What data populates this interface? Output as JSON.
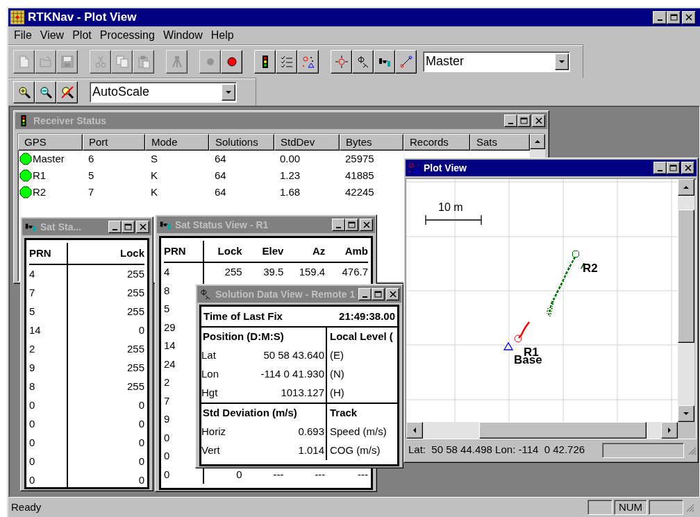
{
  "app": {
    "title": "RTKNav - Plot View"
  },
  "menu": [
    "File",
    "View",
    "Plot",
    "Processing",
    "Window",
    "Help"
  ],
  "toolbar": {
    "groups": [
      [
        {
          "kind": "new",
          "disabled": true
        },
        {
          "kind": "open",
          "disabled": true
        },
        {
          "kind": "save",
          "disabled": true
        }
      ],
      [
        {
          "kind": "cut",
          "disabled": true
        },
        {
          "kind": "copy",
          "disabled": true
        },
        {
          "kind": "paste",
          "disabled": true
        }
      ],
      [
        {
          "kind": "tripod",
          "disabled": true
        }
      ],
      [
        {
          "kind": "stop",
          "disabled": true
        },
        {
          "kind": "record",
          "disabled": false
        }
      ],
      [
        {
          "kind": "traffic",
          "disabled": false
        },
        {
          "kind": "checklist",
          "disabled": false
        },
        {
          "kind": "scatter",
          "disabled": false
        }
      ],
      [
        {
          "kind": "crosshair",
          "disabled": false
        },
        {
          "kind": "phi",
          "disabled": false
        },
        {
          "kind": "nodes",
          "disabled": false
        },
        {
          "kind": "link",
          "disabled": false
        }
      ]
    ],
    "receiver_select": "Master"
  },
  "zoom_toolbar": {
    "buttons": [
      {
        "kind": "zoom_in",
        "disabled": false
      },
      {
        "kind": "zoom_out",
        "disabled": false
      },
      {
        "kind": "zoom_reset",
        "disabled": false
      }
    ],
    "scale_select": "AutoScale"
  },
  "receiver_status": {
    "title": "Receiver Status",
    "active": false,
    "columns": [
      "GPS",
      "Port",
      "Mode",
      "Solutions",
      "StdDev",
      "Bytes",
      "Records",
      "Sats"
    ],
    "rows": [
      {
        "cells": [
          "Master",
          "6",
          "S",
          "64",
          "0.00",
          "25975"
        ],
        "color": "#00ff00"
      },
      {
        "cells": [
          "R1",
          "5",
          "K",
          "64",
          "1.23",
          "41885"
        ],
        "color": "#00ff00"
      },
      {
        "cells": [
          "R2",
          "7",
          "K",
          "64",
          "1.68",
          "42245"
        ],
        "color": "#00ff00"
      }
    ]
  },
  "sat_status_small": {
    "title": "Sat Sta...",
    "active": false,
    "columns": [
      "PRN",
      "Lock"
    ],
    "rows": [
      [
        "4",
        "255"
      ],
      [
        "7",
        "255"
      ],
      [
        "5",
        "255"
      ],
      [
        "14",
        "0"
      ],
      [
        "2",
        "255"
      ],
      [
        "9",
        "255"
      ],
      [
        "8",
        "255"
      ],
      [
        "0",
        "0"
      ],
      [
        "0",
        "0"
      ],
      [
        "0",
        "0"
      ],
      [
        "0",
        "0"
      ],
      [
        "0",
        "0"
      ]
    ]
  },
  "sat_status_r1": {
    "title": "Sat Status View - R1",
    "active": false,
    "columns": [
      "PRN",
      "Lock",
      "Elev",
      "Az",
      "Amb"
    ],
    "rows": [
      [
        "4",
        "255",
        "39.5",
        "159.4",
        "476.7"
      ],
      [
        "8"
      ],
      [
        "5"
      ],
      [
        "29"
      ],
      [
        "14"
      ],
      [
        "24"
      ],
      [
        "2"
      ],
      [
        "7"
      ],
      [
        "9"
      ],
      [
        "0"
      ],
      [
        "0"
      ],
      [
        "0",
        "0",
        "---",
        "---",
        "---"
      ]
    ]
  },
  "solution_data": {
    "title": "Solution Data View - Remote 1",
    "active": false,
    "time_label": "Time of Last Fix",
    "time_value": "21:49:38.00",
    "sections": [
      {
        "heading": "Position (D:M:S)",
        "rows": [
          {
            "label": "Lat",
            "value": "50 58 43.640"
          },
          {
            "label": "Lon",
            "value": "-114 0 41.930"
          },
          {
            "label": "Hgt",
            "value": "1013.127"
          }
        ],
        "side_heading": "Local Level (",
        "side_rows": [
          "(E)",
          "(N)",
          "(H)"
        ]
      },
      {
        "heading": "Std Deviation (m/s)",
        "rows": [
          {
            "label": "Horiz",
            "value": "0.693"
          },
          {
            "label": "Vert",
            "value": "1.014"
          }
        ],
        "side_heading": "Track",
        "side_rows": [
          "Speed (m/s)",
          "COG (m/s)"
        ]
      }
    ]
  },
  "plot_view": {
    "title": "Plot View",
    "active": true,
    "scale_label": "10 m",
    "markers": [
      {
        "kind": "base",
        "label": "Base",
        "color": "#0000ff"
      },
      {
        "kind": "remote",
        "label": "R1",
        "color": "#ff0000"
      },
      {
        "kind": "remote",
        "label": "R2",
        "color": "#008000"
      }
    ],
    "cursor_readout": "Lat:  50 58 44.498 Lon: -114  0 42.726"
  },
  "status_bar": {
    "text": "Ready",
    "num_lock": "NUM"
  }
}
